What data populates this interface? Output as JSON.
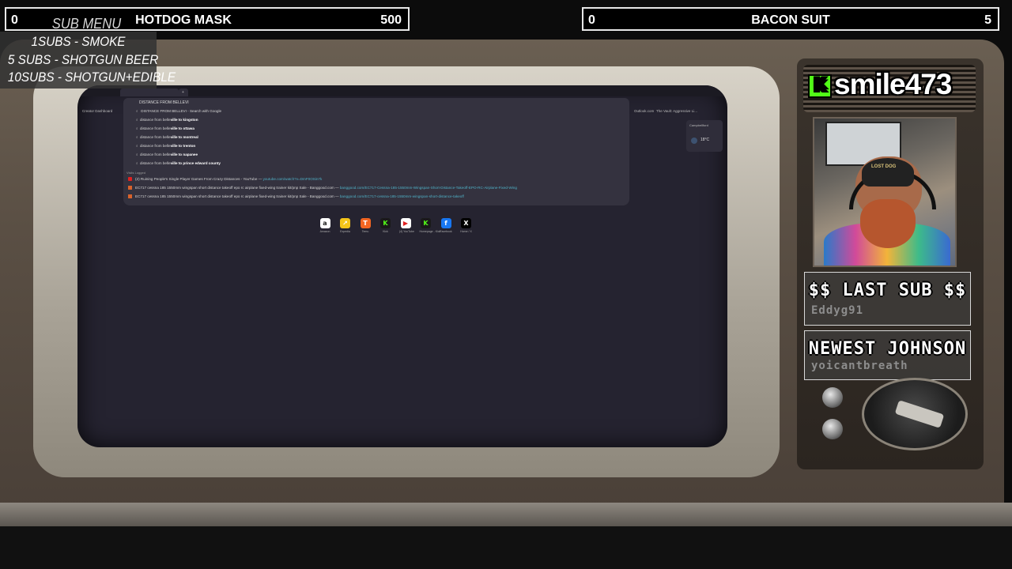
{
  "goals": [
    {
      "current": "0",
      "name": "HOTDOG MASK",
      "target": "500"
    },
    {
      "current": "0",
      "name": "BACON SUIT",
      "target": "5"
    }
  ],
  "submenu": {
    "title": "SUB MENU",
    "items": [
      "1SUBS   - SMOKE",
      "5 SUBS  - SHOTGUN BEER",
      "10SUBS - SHOTGUN+EDIBLE"
    ]
  },
  "streamer": {
    "name": "smile473",
    "logo_letter": "K"
  },
  "last_sub": {
    "title": "$$ LAST SUB $$",
    "name": "Eddyg91"
  },
  "newest_johnson": {
    "title": "NEWEST JOHNSON",
    "name": "yoicantbreath"
  },
  "webcam": {
    "hat_text": "LOST DOG"
  },
  "browser": {
    "address_text": "DISTANCE FROM BELLEVI",
    "top_suggestion": "DISTANCE FROM BELLEVI - Search with Google",
    "suggestions": [
      {
        "prefix": "distance from belle",
        "bold": "ville to kingston"
      },
      {
        "prefix": "distance from belle",
        "bold": "ville to ottawa"
      },
      {
        "prefix": "distance from belle",
        "bold": "ville to montreal"
      },
      {
        "prefix": "distance from belle",
        "bold": "ville to trenton"
      },
      {
        "prefix": "distance from belle",
        "bold": "ville to napanee"
      },
      {
        "prefix": "distance from belle",
        "bold": "ville to prince edward county"
      }
    ],
    "history_label": "Visits Logged",
    "history": [
      {
        "text": "(2) Ruining People's Single Player Games From Crazy Distances - YouTube",
        "url": "youtube.com/watch?v=DmF0OSin7k"
      },
      {
        "text": "EC717 cessna 185 1550mm wingspan short distance takeoff epo rc airplane fixed-wing trainer kit/pnp Sale - Banggood.com",
        "url": "banggood.com/EC717-Cessna-185-1550mm-Wingspan-Short-Distance-Takeoff-EPO-RC-Airplane-Fixed-Wing"
      },
      {
        "text": "EC717 cessna 185 1550mm wingspan short distance takeoff epo rc airplane fixed-wing trainer kit/pnp Sale - Banggood.com",
        "url": "banggood.com/EC717-cessna-185-1550mm-wingspan-short-distance-takeoff"
      }
    ],
    "bookmarks": [
      "Creator Dashboard",
      "Outlook.com",
      "The Vault: Aggressive Li..."
    ],
    "shortcuts": [
      {
        "label": "Amazon",
        "glyph": "a",
        "color": "#ffffff"
      },
      {
        "label": "Expedia",
        "glyph": "↗",
        "color": "#f4c41a"
      },
      {
        "label": "Temu",
        "glyph": "T",
        "color": "#f26522"
      },
      {
        "label": "Kick",
        "glyph": "K",
        "color": "#1a1a1a"
      },
      {
        "label": "(4) YouTube",
        "glyph": "▶",
        "color": "#ffffff"
      },
      {
        "label": "Homepage - Kick",
        "glyph": "K",
        "color": "#1a1a1a"
      },
      {
        "label": "Facebook",
        "glyph": "f",
        "color": "#1877f2"
      },
      {
        "label": "Home / X",
        "glyph": "X",
        "color": "#000000"
      }
    ],
    "weather": {
      "location": "Campbellford",
      "temp": "18°C"
    }
  }
}
